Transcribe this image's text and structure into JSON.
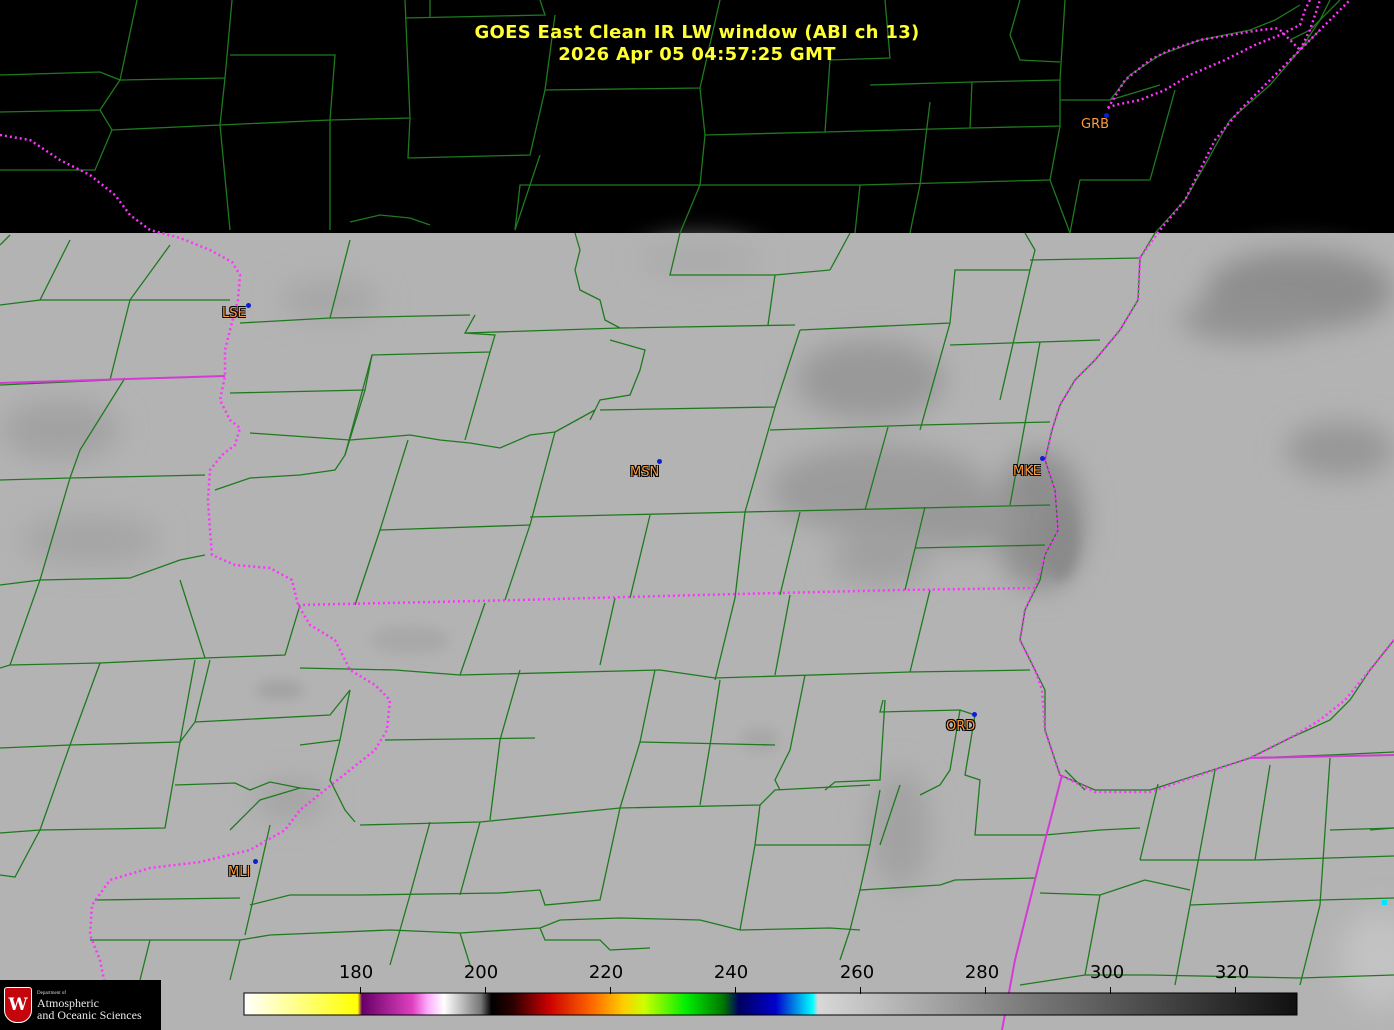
{
  "header": {
    "title_line1": "GOES East Clean IR LW window (ABI ch 13)",
    "title_line2": "2026 Apr 05  04:57:25 GMT"
  },
  "stations": [
    {
      "id": "grb",
      "label": "GRB"
    },
    {
      "id": "lse",
      "label": "LSE"
    },
    {
      "id": "msn",
      "label": "MSN"
    },
    {
      "id": "mke",
      "label": "MKE"
    },
    {
      "id": "ord",
      "label": "ORD"
    },
    {
      "id": "mli",
      "label": "MLI"
    }
  ],
  "colorbar": {
    "tick_labels": [
      "180",
      "200",
      "220",
      "240",
      "260",
      "280",
      "300",
      "320"
    ]
  },
  "logo": {
    "line_small": "Department of",
    "line_1": "Atmospheric",
    "line_2": "and Oceanic Sciences"
  },
  "colors": {
    "title": "#ffff33",
    "county_lines": "#1f7a1f",
    "state_lines": "#d63ad6",
    "shoreline_dots": "#ff33ff",
    "station_label": "#ff9a3c",
    "station_dot": "#0a1ed8",
    "cloud_gray": "#b3b3b3"
  }
}
